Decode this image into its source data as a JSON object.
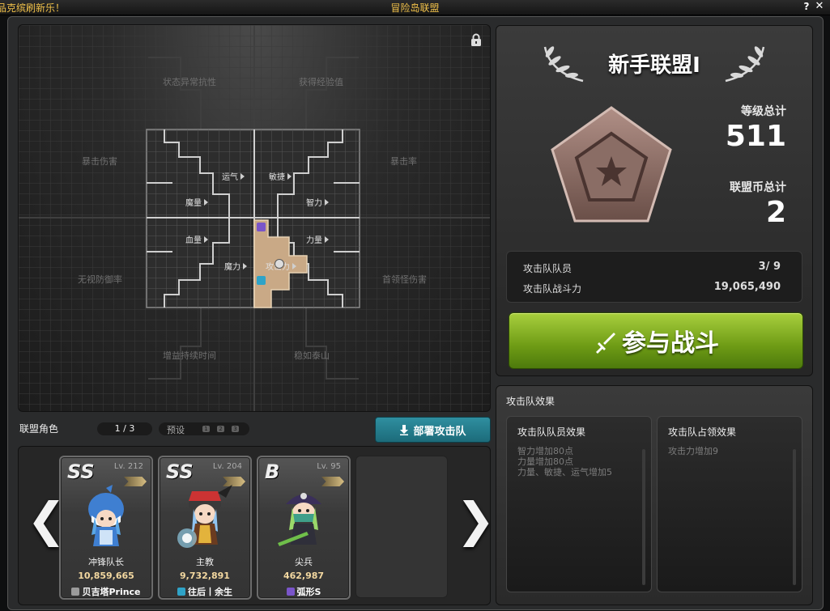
{
  "window": {
    "title": "冒险岛联盟",
    "ticker": "品克缤刷新乐！",
    "help": "?",
    "close": "✕"
  },
  "board": {
    "outer_labels": [
      "状态异常抗性",
      "获得经验值",
      "暴击伤害",
      "暴击率",
      "无视防御率",
      "首领怪伤害",
      "增益持续时间",
      "稳如泰山"
    ],
    "inner_labels": [
      "运气",
      "敏捷",
      "魔量",
      "智力",
      "血量",
      "力量",
      "魔力",
      "攻击力"
    ],
    "lock_icon": "lock-icon"
  },
  "union": {
    "name": "新手联盟Ⅰ",
    "level_label": "等级总计",
    "level_value": "511",
    "coin_label": "联盟币总计",
    "coin_value": "2",
    "crew_label": "攻击队队员",
    "crew_value": "3/ 9",
    "power_label": "攻击队战斗力",
    "power_value": "19,065,490",
    "battle_label": "参与战斗"
  },
  "effects": {
    "header": "攻击队效果",
    "member_title": "攻击队队员效果",
    "member_lines": [
      "智力增加80点",
      "力量增加80点",
      "力量、敏捷、运气增加5"
    ],
    "occupy_title": "攻击队占领效果",
    "occupy_lines": [
      "攻击力增加9"
    ]
  },
  "roster": {
    "title": "联盟角色",
    "page": "1 / 3",
    "preset_label": "预设",
    "preset_slots": [
      "1",
      "2",
      "3"
    ],
    "deploy_label": "部署攻击队",
    "prev": "❮",
    "next": "❯",
    "cards": [
      {
        "rank": "SS",
        "level": "Lv. 212",
        "job": "冲锋队长",
        "power": "10,859,665",
        "name": "贝吉塔Prince",
        "class_color": "#9b9b9b",
        "class_icon": "pirate-class-icon"
      },
      {
        "rank": "SS",
        "level": "Lv. 204",
        "job": "主教",
        "power": "9,732,891",
        "name": "往后丨余生",
        "class_color": "#2fa3c7",
        "class_icon": "mage-class-icon"
      },
      {
        "rank": "B",
        "level": "Lv. 95",
        "job": "尖兵",
        "power": "462,987",
        "name": "弧形S",
        "class_color": "#7a55c9",
        "class_icon": "xenon-class-icon"
      }
    ]
  },
  "colors": {
    "accent_gold": "#f2c24a",
    "battle_green": "#7aa81d",
    "deploy_teal": "#1f7788"
  }
}
